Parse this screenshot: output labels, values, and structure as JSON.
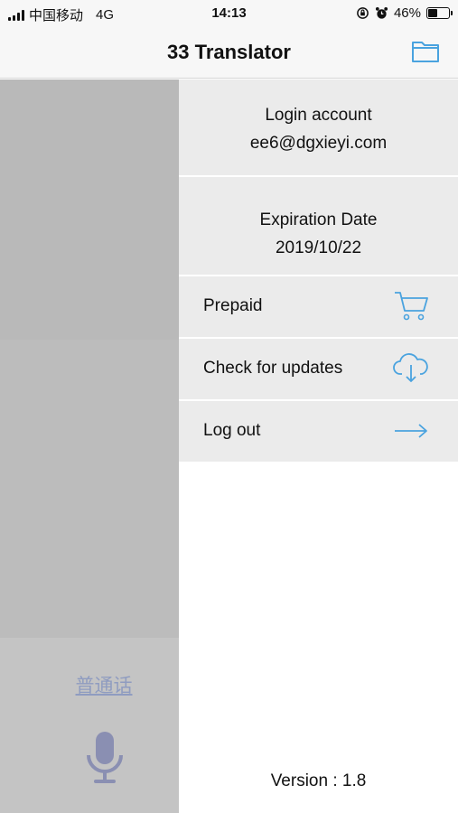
{
  "status_bar": {
    "carrier": "中国移动",
    "network": "4G",
    "time": "14:13",
    "battery": "46%",
    "battery_level": 0.46
  },
  "nav": {
    "title": "33 Translator",
    "folder_icon": "folder-icon"
  },
  "main": {
    "language": "普通话",
    "mic_icon": "microphone-icon"
  },
  "drawer": {
    "login_label": "Login account",
    "login_value": "ee6@dgxieyi.com",
    "expiration_label": "Expiration Date",
    "expiration_value": "2019/10/22",
    "menu": [
      {
        "label": "Prepaid",
        "icon": "cart-icon"
      },
      {
        "label": "Check for updates",
        "icon": "cloud-download-icon"
      },
      {
        "label": "Log out",
        "icon": "arrow-right-icon"
      }
    ],
    "version": "Version : 1.8"
  },
  "colors": {
    "accent": "#4aa3df",
    "drawer_row": "#ebebeb",
    "overlay": "#c4c4c4",
    "mic": "#8a8fb2"
  }
}
